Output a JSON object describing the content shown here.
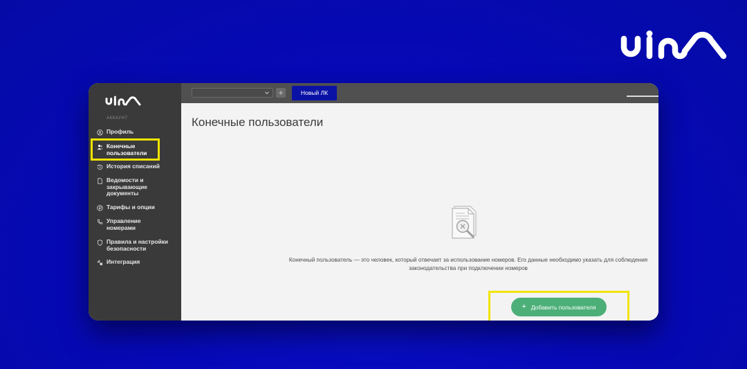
{
  "header": {
    "new_lk_label": "Новый ЛК",
    "add_symbol": "+"
  },
  "sidebar": {
    "section_label": "АККАУНТ",
    "items": [
      {
        "label": "Профиль",
        "icon": "user-circle-icon"
      },
      {
        "label": "Конечные пользователи",
        "icon": "users-icon",
        "active": true
      },
      {
        "label": "История списаний",
        "icon": "history-icon"
      },
      {
        "label": "Ведомости и закрывающие документы",
        "icon": "document-icon"
      },
      {
        "label": "Тарифы и опции",
        "icon": "tariff-icon"
      },
      {
        "label": "Управление номерами",
        "icon": "phone-icon"
      },
      {
        "label": "Правила и настройки безопасности",
        "icon": "shield-icon"
      },
      {
        "label": "Интеграция",
        "icon": "integration-icon"
      }
    ]
  },
  "main": {
    "title": "Конечные пользователи",
    "empty_state": {
      "icon": "document-search-icon",
      "description": "Конечный пользователь — это человек, который отвечает за использование номеров. Его данные необходимо указать для соблюдения законодательства при подключении номеров",
      "button_icon": "+",
      "button_label": "Добавить пользователя"
    }
  },
  "colors": {
    "background": "#0609b8",
    "sidebar": "#3a3a3a",
    "topbar": "#505050",
    "new_lk_button": "#0a12a6",
    "add_button": "#4caf78",
    "highlight": "#f2e400"
  }
}
